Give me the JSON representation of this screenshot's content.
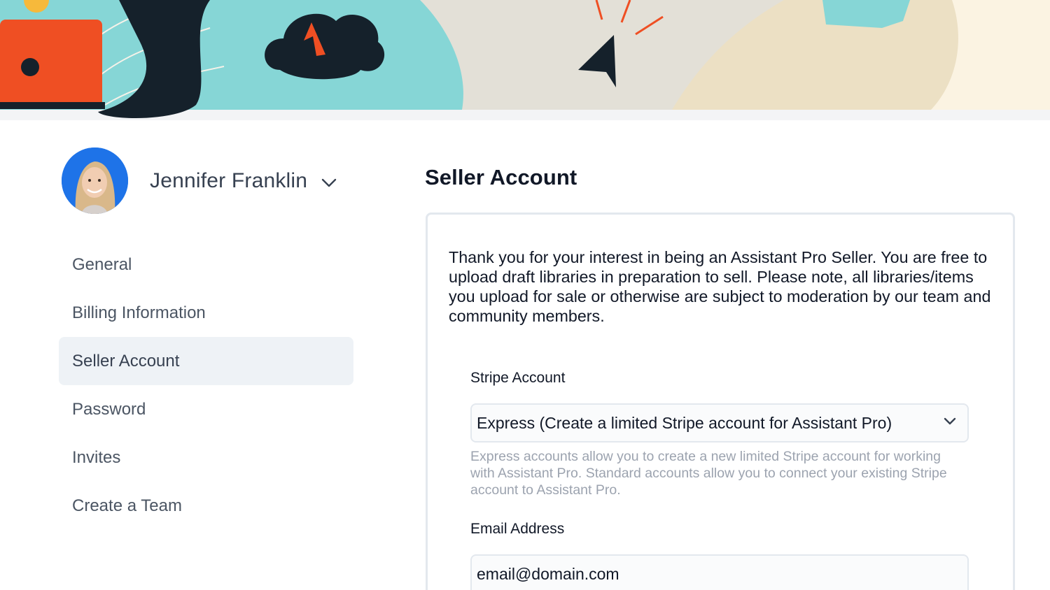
{
  "user": {
    "name": "Jennifer Franklin",
    "avatar_icon": "profile-photo",
    "menu_icon": "chevron-down-icon"
  },
  "sidebar": {
    "items": [
      {
        "label": "General",
        "active": false
      },
      {
        "label": "Billing Information",
        "active": false
      },
      {
        "label": "Seller Account",
        "active": true
      },
      {
        "label": "Password",
        "active": false
      },
      {
        "label": "Invites",
        "active": false
      },
      {
        "label": "Create a Team",
        "active": false
      }
    ]
  },
  "main": {
    "title": "Seller Account",
    "intro": "Thank you for your interest in being an Assistant Pro Seller. You are free to upload draft libraries in preparation to sell. Please note, all libraries/items you upload for sale or otherwise are subject to moderation by our team and community members.",
    "stripe": {
      "label": "Stripe Account",
      "selected": "Express (Create a limited Stripe account for Assistant Pro)",
      "help": "Express accounts allow you to create a new limited Stripe account for working with Assistant Pro. Standard accounts allow you to connect your existing Stripe account to Assistant Pro."
    },
    "email": {
      "label": "Email Address",
      "value": "email@domain.com"
    }
  },
  "colors": {
    "teal": "#86d6d6",
    "orange": "#ef4f23",
    "dark": "#15212b",
    "beige": "#e5e1d8",
    "cream": "#fbf3e2",
    "active_bg": "#eef2f6",
    "avatar_bg": "#1e73e8"
  }
}
